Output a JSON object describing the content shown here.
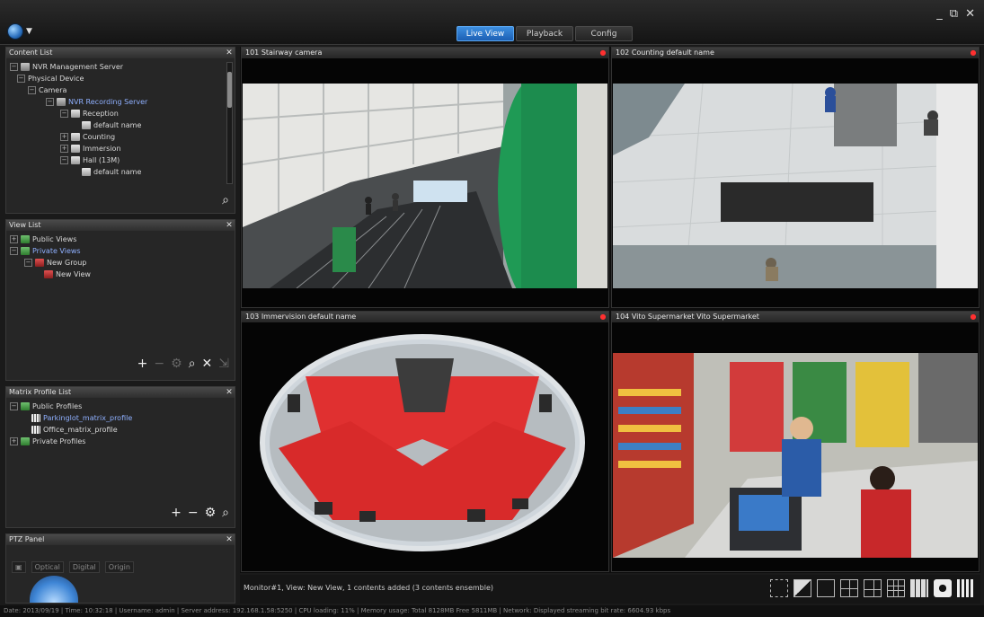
{
  "topbar": {
    "tabs": [
      {
        "label": "Live View",
        "active": true
      },
      {
        "label": "Playback",
        "active": false
      },
      {
        "label": "Config",
        "active": false
      }
    ],
    "window_controls": [
      "_",
      "⧉",
      "✕"
    ]
  },
  "content_list": {
    "title": "Content List",
    "items": [
      {
        "label": "NVR Management Server",
        "depth": 0,
        "icon": "server-icon"
      },
      {
        "label": "Physical Device",
        "depth": 1,
        "icon": ""
      },
      {
        "label": "Camera",
        "depth": 2,
        "icon": ""
      },
      {
        "label": "NVR Recording Server",
        "depth": 3,
        "icon": "server-icon",
        "highlight": true
      },
      {
        "label": "Reception",
        "depth": 4,
        "icon": "camera-icon"
      },
      {
        "label": "default name",
        "depth": 5,
        "icon": "camera-icon"
      },
      {
        "label": "Counting",
        "depth": 4,
        "icon": "camera-icon"
      },
      {
        "label": "Immersion",
        "depth": 4,
        "icon": "camera-icon"
      },
      {
        "label": "Hall (13M)",
        "depth": 4,
        "icon": "camera-icon"
      },
      {
        "label": "default name",
        "depth": 5,
        "icon": "camera-icon"
      }
    ]
  },
  "view_list": {
    "title": "View List",
    "items": [
      {
        "label": "Public Views",
        "depth": 0,
        "highlight": false
      },
      {
        "label": "Private Views",
        "depth": 0,
        "highlight": true
      },
      {
        "label": "New Group",
        "depth": 1,
        "highlight": false
      },
      {
        "label": "New View",
        "depth": 2,
        "highlight": false
      }
    ]
  },
  "matrix_list": {
    "title": "Matrix Profile List",
    "items": [
      {
        "label": "Public Profiles",
        "depth": 0,
        "highlight": false
      },
      {
        "label": "Parkinglot_matrix_profile",
        "depth": 1,
        "highlight": true
      },
      {
        "label": "Office_matrix_profile",
        "depth": 1,
        "highlight": false
      },
      {
        "label": "Private Profiles",
        "depth": 0,
        "highlight": false
      }
    ]
  },
  "ptz_panel": {
    "title": "PTZ Panel",
    "tabs": [
      "Optical",
      "Digital",
      "Origin"
    ]
  },
  "tiles": [
    {
      "title": "101 Stairway camera"
    },
    {
      "title": "102 Counting default name"
    },
    {
      "title": "103 Immervision default name"
    },
    {
      "title": "104 Vito Supermarket Vito Supermarket"
    }
  ],
  "bottom": {
    "message": "Monitor#1, View: New View, 1 contents added (3 contents ensemble)"
  },
  "status": {
    "text": "Date: 2013/09/19 | Time: 10:32:18 | Username: admin | Server address: 192.168.1.58:5250 | CPU loading: 11% | Memory usage: Total 8128MB Free 5811MB | Network: Displayed streaming bit rate: 6604.93 kbps"
  }
}
